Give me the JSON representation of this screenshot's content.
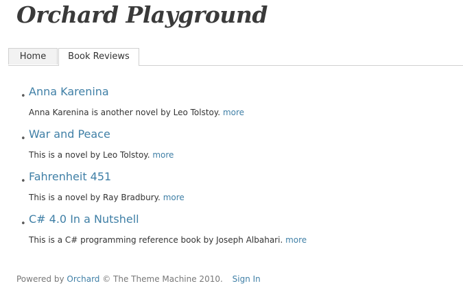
{
  "site": {
    "title": "Orchard Playground"
  },
  "tabs": [
    {
      "label": "Home"
    },
    {
      "label": "Book Reviews"
    }
  ],
  "books": [
    {
      "title": "Anna Karenina",
      "description": "Anna Karenina is another novel by Leo Tolstoy.",
      "more": "more"
    },
    {
      "title": "War and Peace",
      "description": "This is a novel by Leo Tolstoy.",
      "more": "more"
    },
    {
      "title": "Fahrenheit 451",
      "description": "This is a novel by Ray Bradbury.",
      "more": "more"
    },
    {
      "title": "C# 4.0 In a Nutshell",
      "description": "This is a C# programming reference book by Joseph Albahari.",
      "more": "more"
    }
  ],
  "footer": {
    "powered_by": "Powered by",
    "orchard_link": "Orchard",
    "copyright": "© The Theme Machine 2010.",
    "sign_in": "Sign In"
  },
  "colors": {
    "link": "#3f7fa6",
    "text": "#333333",
    "muted": "#777777"
  }
}
